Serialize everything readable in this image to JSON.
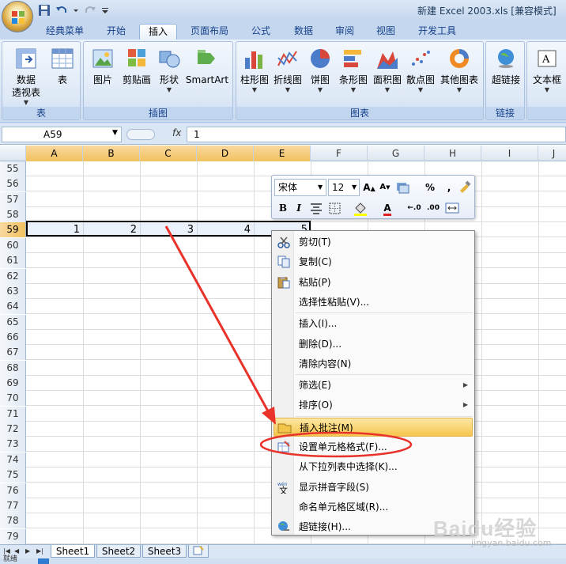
{
  "window": {
    "title": "新建 Excel 2003.xls  [兼容模式]"
  },
  "quick_access": {
    "icons": [
      "save-icon",
      "undo-icon",
      "redo-icon",
      "customize-icon"
    ]
  },
  "tabs": [
    {
      "label": "经典菜单"
    },
    {
      "label": "开始"
    },
    {
      "label": "插入",
      "active": true
    },
    {
      "label": "页面布局"
    },
    {
      "label": "公式"
    },
    {
      "label": "数据"
    },
    {
      "label": "审阅"
    },
    {
      "label": "视图"
    },
    {
      "label": "开发工具"
    }
  ],
  "ribbon": {
    "groups": [
      {
        "label": "表",
        "buttons": [
          {
            "label": "数据\n透视表",
            "has_dropdown": true
          },
          {
            "label": "表"
          }
        ]
      },
      {
        "label": "插图",
        "buttons": [
          {
            "label": "图片"
          },
          {
            "label": "剪贴画"
          },
          {
            "label": "形状",
            "has_dropdown": true
          },
          {
            "label": "SmartArt"
          }
        ]
      },
      {
        "label": "图表",
        "buttons": [
          {
            "label": "柱形图"
          },
          {
            "label": "折线图"
          },
          {
            "label": "饼图"
          },
          {
            "label": "条形图"
          },
          {
            "label": "面积图"
          },
          {
            "label": "散点图"
          },
          {
            "label": "其他图表"
          }
        ]
      },
      {
        "label": "链接",
        "buttons": [
          {
            "label": "超链接"
          }
        ]
      },
      {
        "label": "",
        "buttons": [
          {
            "label": "文本框"
          }
        ]
      }
    ]
  },
  "formula_bar": {
    "name_box": "A59",
    "fx": "fx",
    "value": "1"
  },
  "columns": [
    "A",
    "B",
    "C",
    "D",
    "E",
    "F",
    "G",
    "H",
    "I",
    "J"
  ],
  "rows": [
    "55",
    "56",
    "57",
    "58",
    "59",
    "60",
    "61",
    "62",
    "63",
    "64",
    "65",
    "66",
    "67",
    "68",
    "69",
    "70",
    "71",
    "72",
    "73",
    "74",
    "75",
    "76",
    "77",
    "78",
    "79"
  ],
  "selected_row": "59",
  "row59_values": [
    "1",
    "2",
    "3",
    "4",
    "5"
  ],
  "mini_toolbar": {
    "font": "宋体",
    "size": "12",
    "percent": "%",
    "comma": ","
  },
  "context_menu": {
    "items": [
      {
        "label": "剪切(T)",
        "icon": "scissors-icon"
      },
      {
        "label": "复制(C)",
        "icon": "copy-icon"
      },
      {
        "label": "粘贴(P)",
        "icon": "paste-icon"
      },
      {
        "label": "选择性粘贴(V)..."
      },
      {
        "label": "插入(I)..."
      },
      {
        "label": "删除(D)..."
      },
      {
        "label": "清除内容(N)"
      },
      {
        "label": "筛选(E)",
        "submenu": true
      },
      {
        "label": "排序(O)",
        "submenu": true
      },
      {
        "label": "插入批注(M)",
        "icon": "comment-icon",
        "highlighted": true
      },
      {
        "label": "设置单元格格式(F)...",
        "icon": "format-cells-icon"
      },
      {
        "label": "从下拉列表中选择(K)..."
      },
      {
        "label": "显示拼音字段(S)",
        "icon": "phonetic-icon"
      },
      {
        "label": "命名单元格区域(R)..."
      },
      {
        "label": "超链接(H)...",
        "icon": "hyperlink-icon"
      }
    ]
  },
  "sheets": [
    {
      "label": "Sheet1",
      "active": true
    },
    {
      "label": "Sheet2"
    },
    {
      "label": "Sheet3"
    }
  ],
  "status": {
    "text": "就绪"
  },
  "watermark": {
    "brand": "Baidu经验",
    "url": "jingyan.baidu.com"
  },
  "colors": {
    "ribbon": "#dce7f5",
    "highlight": "#f6c64d",
    "annotation": "#e8322a",
    "selected_header": "#f1c15f"
  }
}
